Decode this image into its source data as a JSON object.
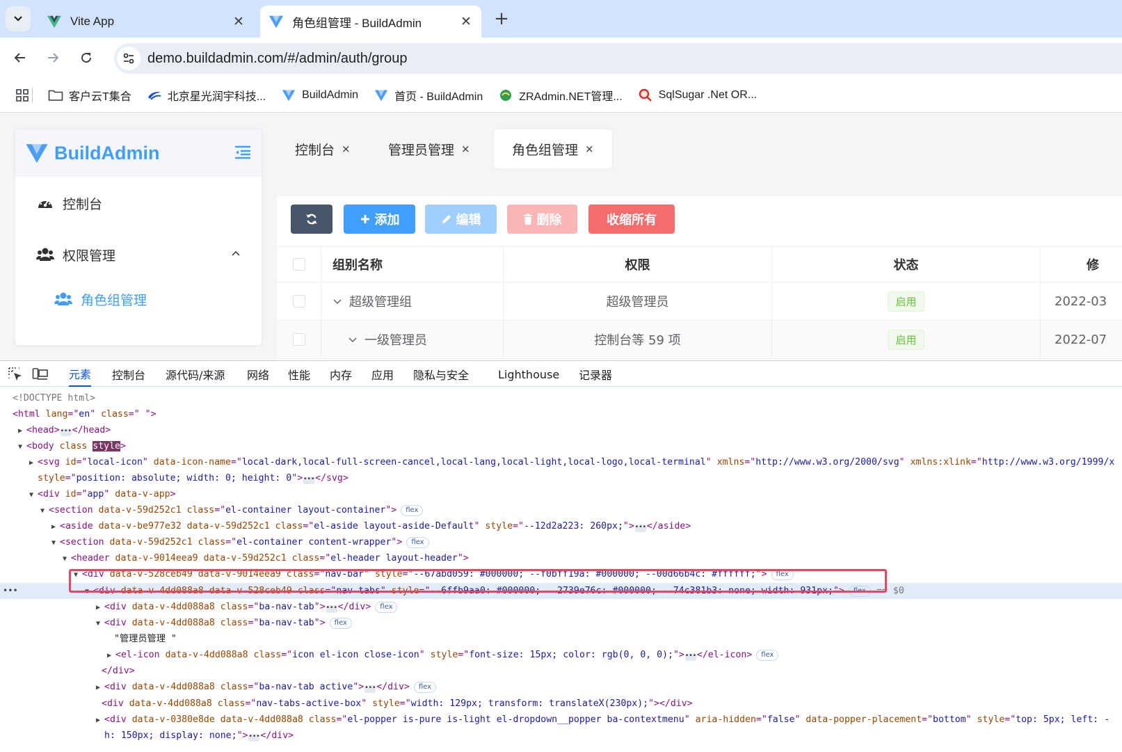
{
  "browser": {
    "tabs": [
      {
        "title": "Vite App",
        "close": "✕"
      },
      {
        "title": "角色组管理 - BuildAdmin",
        "close": "✕"
      }
    ],
    "new_tab": "+",
    "url": "demo.buildadmin.com/#/admin/auth/group",
    "bookmarks": [
      "客户云T集合",
      "北京星光润宇科技...",
      "BuildAdmin",
      "首页 - BuildAdmin",
      "ZRAdmin.NET管理...",
      "SqlSugar .Net OR..."
    ]
  },
  "colors": {
    "brand": "#409eff",
    "danger": "#f56c6c",
    "success": "#67c23a",
    "dark": "#475669"
  },
  "sidebar": {
    "logo": "BuildAdmin",
    "items": [
      {
        "label": "控制台",
        "icon": "dashboard-icon"
      },
      {
        "label": "权限管理",
        "icon": "users-icon"
      },
      {
        "label": "角色组管理",
        "icon": "users-icon"
      }
    ]
  },
  "nav_tabs": [
    {
      "label": "控制台",
      "close": "×"
    },
    {
      "label": "管理员管理",
      "close": "×"
    },
    {
      "label": "角色组管理",
      "close": "×"
    }
  ],
  "toolbar": {
    "add": "添加",
    "edit": "编辑",
    "delete": "删除",
    "collapse_all": "收缩所有"
  },
  "table": {
    "columns": [
      "组别名称",
      "权限",
      "状态",
      "修"
    ],
    "rows": [
      {
        "name": "超级管理组",
        "rules": "超级管理员",
        "status": "启用",
        "updated": "2022-03"
      },
      {
        "name": "一级管理员",
        "rules": "控制台等 59 项",
        "status": "启用",
        "updated": "2022-07"
      }
    ]
  },
  "devtools": {
    "tabs": [
      "元素",
      "控制台",
      "源代码/来源",
      "网络",
      "性能",
      "内存",
      "应用",
      "隐私与安全",
      "Lighthouse",
      "记录器"
    ],
    "lines": {
      "l0": "<!DOCTYPE html>",
      "l1": [
        "<html ",
        "lang",
        "=\"",
        "en",
        "\" ",
        "class",
        "=\"",
        " ",
        "\">"
      ],
      "l2": [
        "<head>",
        "</head>"
      ],
      "l3": [
        "<body ",
        "class ",
        "style",
        ">"
      ],
      "l4": [
        "<svg ",
        "id",
        "=\"",
        "local-icon",
        "\" ",
        "data-icon-name",
        "=\"",
        "local-dark,local-full-screen-cancel,local-lang,local-light,local-logo,local-terminal",
        "\" ",
        "xmlns",
        "=\"",
        "http://www.w3.org/2000/svg",
        "\" ",
        "xmlns:xlink",
        "=\"",
        "http://www.w3.org/1999/x"
      ],
      "l5": [
        "style",
        "=\"",
        "position: absolute; width: 0; height: 0",
        "\">",
        "</svg>"
      ],
      "l6": [
        "<div ",
        "id",
        "=\"",
        "app",
        "\" ",
        "data-v-app",
        ">"
      ],
      "l7": [
        "<section ",
        "data-v-59d252c1 ",
        "class",
        "=\"",
        "el-container layout-container",
        "\">",
        "flex"
      ],
      "l8": [
        "<aside ",
        "data-v-be977e32 data-v-59d252c1 ",
        "class",
        "=\"",
        "el-aside layout-aside-Default",
        "\" ",
        "style",
        "=\"",
        "--12d2a223: 260px;",
        "\">",
        "</aside>"
      ],
      "l9": [
        "<section ",
        "data-v-59d252c1 ",
        "class",
        "=\"",
        "el-container content-wrapper",
        "\">",
        "flex"
      ],
      "l10": [
        "<header ",
        "data-v-9014eea9 data-v-59d252c1 ",
        "class",
        "=\"",
        "el-header layout-header",
        "\">"
      ],
      "l11": [
        "<div ",
        "data-v-528ceb49 data-v-9014eea9 ",
        "class",
        "=\"",
        "nav-bar",
        "\" ",
        "style",
        "=\"",
        "--67abd059: #000000; --f0bff19a: #000000; --00d66b4c: #ffffff;",
        "\">",
        "flex"
      ],
      "l12": [
        "<div ",
        "data-v-4dd088a8 data-v-528ceb49 ",
        "class",
        "=\"",
        "nav-tabs",
        "\" ",
        "style",
        "=\"",
        "--6ffb9aa0: #000000; --2739e76c: #000000; --74c381b3: none; width: 931px;",
        "\">",
        "flex",
        "== $0"
      ],
      "l13": [
        "<div ",
        "data-v-4dd088a8 ",
        "class",
        "=\"",
        "ba-nav-tab",
        "\">",
        "</div>",
        "flex"
      ],
      "l14": [
        "<div ",
        "data-v-4dd088a8 ",
        "class",
        "=\"",
        "ba-nav-tab",
        "\">",
        "flex"
      ],
      "l15": "\"管理员管理 \"",
      "l16": [
        "<el-icon ",
        "data-v-4dd088a8 ",
        "class",
        "=\"",
        "icon el-icon close-icon",
        "\" ",
        "style",
        "=\"",
        "font-size: 15px; color: rgb(0, 0, 0);",
        "\">",
        "</el-icon>",
        "flex"
      ],
      "l17": "</div>",
      "l18": [
        "<div ",
        "data-v-4dd088a8 ",
        "class",
        "=\"",
        "ba-nav-tab active",
        "\">",
        "</div>",
        "flex"
      ],
      "l19": [
        "<div ",
        "data-v-4dd088a8 ",
        "class",
        "=\"",
        "nav-tabs-active-box",
        "\" ",
        "style",
        "=\"",
        "width: 129px; transform: translateX(230px);",
        "\">",
        "</div>"
      ],
      "l20": [
        "<div ",
        "data-v-0380e8de data-v-4dd088a8 ",
        "class",
        "=\"",
        "el-popper is-pure is-light el-dropdown__popper ba-contextmenu",
        "\" ",
        "aria-hidden",
        "=\"",
        "false",
        "\" ",
        "data-popper-placement",
        "=\"",
        "bottom",
        "\" ",
        "style",
        "=\"",
        "top: 5px; left: -"
      ],
      "l21": [
        "h: 150px; display: none;",
        "\">",
        "</div>"
      ]
    }
  }
}
